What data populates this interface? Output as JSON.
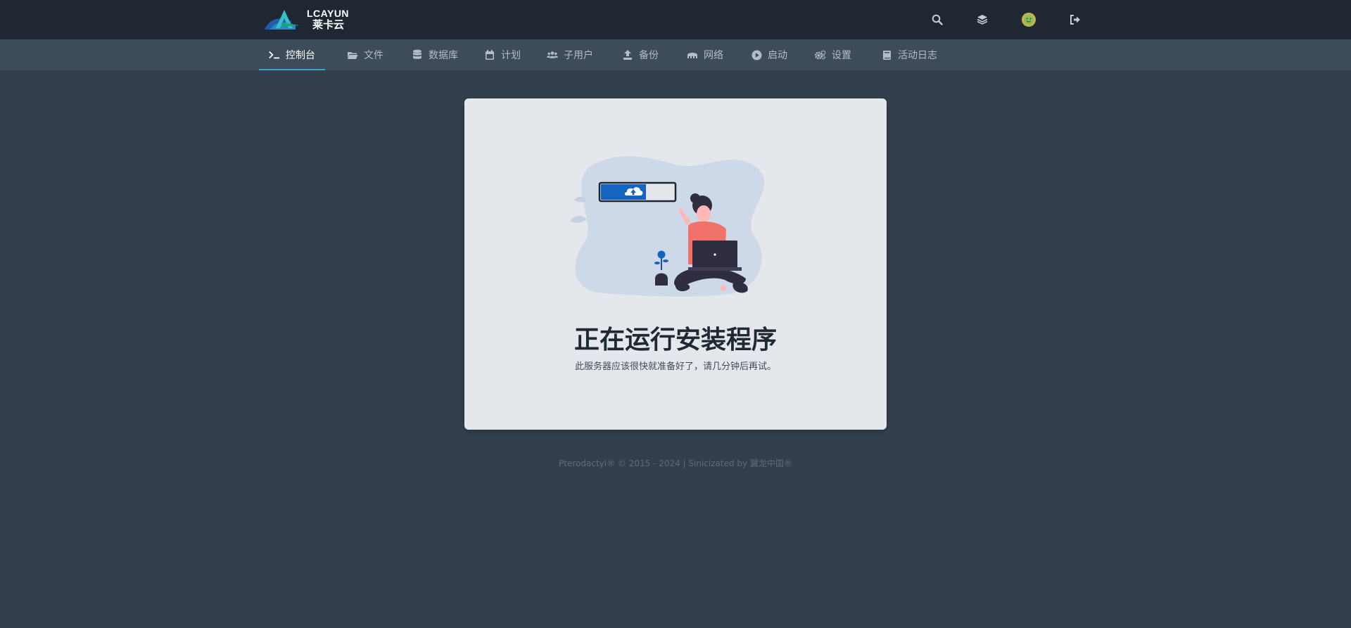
{
  "brand": {
    "logo_text": "LCAYUN",
    "logo_sub": "莱卡云"
  },
  "topbar": {
    "icons": [
      "search-icon",
      "layers-icon",
      "avatar",
      "logout-icon"
    ]
  },
  "nav": {
    "items": [
      {
        "label": "控制台",
        "icon": "console-icon",
        "active": true
      },
      {
        "label": "文件",
        "icon": "folder-icon"
      },
      {
        "label": "数据库",
        "icon": "database-icon"
      },
      {
        "label": "计划",
        "icon": "calendar-icon"
      },
      {
        "label": "子用户",
        "icon": "users-icon"
      },
      {
        "label": "备份",
        "icon": "upload-icon"
      },
      {
        "label": "网络",
        "icon": "network-icon"
      },
      {
        "label": "启动",
        "icon": "play-icon"
      },
      {
        "label": "设置",
        "icon": "gears-icon"
      },
      {
        "label": "活动日志",
        "icon": "book-icon"
      }
    ]
  },
  "main": {
    "title": "正在运行安装程序",
    "description": "此服务器应该很快就准备好了，请几分钟后再试。"
  },
  "footer": {
    "text": "Pterodactyl® © 2015 - 2024 | Sinicizated by 翼龙中国®"
  },
  "colors": {
    "topbar_bg": "#1f2733",
    "navbar_bg": "#3e4b59",
    "page_bg": "#333f4d",
    "card_bg": "#e4e7eb",
    "accent": "#3ba3c7",
    "progress_blue": "#1565c0"
  }
}
